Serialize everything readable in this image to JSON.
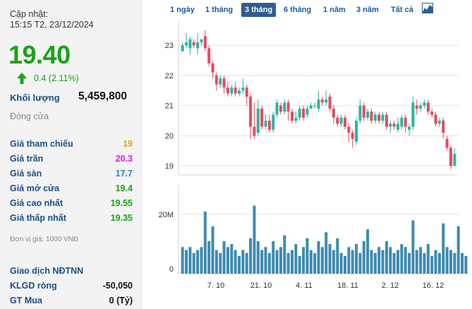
{
  "update": {
    "label": "Cập nhật:",
    "time": "15:15 T2, 23/12/2024"
  },
  "price": "19.40",
  "change": "0.4 (2.11%)",
  "volume": {
    "label": "Khối lượng",
    "value": "5,459,800"
  },
  "status": "Đóng cửa",
  "stats": [
    {
      "label": "Giá tham chiếu",
      "value": "19",
      "color": "#e8a600"
    },
    {
      "label": "Giá trần",
      "value": "20.3",
      "color": "#e020c8"
    },
    {
      "label": "Giá sàn",
      "value": "17.7",
      "color": "#2a87b8"
    },
    {
      "label": "Giá mở cửa",
      "value": "19.4",
      "color": "#1aa21a"
    },
    {
      "label": "Giá cao nhất",
      "value": "19.55",
      "color": "#1aa21a"
    },
    {
      "label": "Giá thấp nhất",
      "value": "19.35",
      "color": "#1aa21a"
    }
  ],
  "unit_note": "Đơn vị giá: 1000 VNĐ",
  "foreign": {
    "title": "Giao dịch NĐTNN",
    "rows": [
      {
        "label": "KLGD ròng",
        "value": "-50,050",
        "color": "#111111"
      },
      {
        "label": "GT Mua",
        "value": "0 (Tỷ)",
        "color": "#111111"
      }
    ]
  },
  "tabs": [
    "1 ngày",
    "1 tháng",
    "3 tháng",
    "6 tháng",
    "1 năm",
    "3 năm",
    "Tất cả"
  ],
  "active_tab": "3 tháng",
  "icons": {
    "chart_type": "area-chart-icon",
    "change_arrow": "up-arrow-icon"
  },
  "colors": {
    "up": "#2bb5a0",
    "down": "#e84a5f",
    "volume": "#3d8bb0",
    "accent_blue": "#2d5d94"
  },
  "chart_data": [
    {
      "type": "candlestick",
      "x_tick_labels": [
        "7. 10",
        "21. 10",
        "4. 11",
        "18. 11",
        "2. 12",
        "16. 12"
      ],
      "y_tick_labels": [
        "19",
        "20",
        "21",
        "22",
        "23"
      ],
      "ylim": [
        18.7,
        23.8
      ],
      "candles": [
        {
          "o": 22.8,
          "c": 23.0,
          "h": 23.1,
          "l": 22.8
        },
        {
          "o": 23.0,
          "c": 23.1,
          "h": 23.4,
          "l": 22.9
        },
        {
          "o": 22.9,
          "c": 23.2,
          "h": 23.3,
          "l": 22.7
        },
        {
          "o": 23.1,
          "c": 23.0,
          "h": 23.2,
          "l": 22.9
        },
        {
          "o": 22.9,
          "c": 23.1,
          "h": 23.4,
          "l": 22.7
        },
        {
          "o": 23.1,
          "c": 23.2,
          "h": 23.2,
          "l": 23.0
        },
        {
          "o": 23.3,
          "c": 22.9,
          "h": 23.5,
          "l": 22.8
        },
        {
          "o": 22.9,
          "c": 22.4,
          "h": 23.0,
          "l": 22.3
        },
        {
          "o": 22.4,
          "c": 22.1,
          "h": 22.5,
          "l": 21.9
        },
        {
          "o": 22.0,
          "c": 21.7,
          "h": 22.1,
          "l": 21.5
        },
        {
          "o": 21.7,
          "c": 21.9,
          "h": 22.0,
          "l": 21.6
        },
        {
          "o": 21.9,
          "c": 21.6,
          "h": 22.0,
          "l": 21.4
        },
        {
          "o": 21.6,
          "c": 21.4,
          "h": 21.8,
          "l": 21.3
        },
        {
          "o": 21.4,
          "c": 21.6,
          "h": 21.7,
          "l": 21.3
        },
        {
          "o": 21.6,
          "c": 21.4,
          "h": 21.8,
          "l": 21.3
        },
        {
          "o": 21.4,
          "c": 21.5,
          "h": 21.6,
          "l": 21.3
        },
        {
          "o": 21.5,
          "c": 21.6,
          "h": 21.9,
          "l": 21.4
        },
        {
          "o": 21.6,
          "c": 21.3,
          "h": 21.7,
          "l": 21.0
        },
        {
          "o": 21.3,
          "c": 20.3,
          "h": 21.4,
          "l": 19.9
        },
        {
          "o": 20.3,
          "c": 20.0,
          "h": 21.1,
          "l": 19.9
        },
        {
          "o": 20.1,
          "c": 20.9,
          "h": 21.2,
          "l": 20.0
        },
        {
          "o": 20.9,
          "c": 20.3,
          "h": 21.0,
          "l": 20.2
        },
        {
          "o": 20.3,
          "c": 20.5,
          "h": 20.7,
          "l": 20.2
        },
        {
          "o": 20.5,
          "c": 20.2,
          "h": 20.7,
          "l": 20.1
        },
        {
          "o": 20.2,
          "c": 20.7,
          "h": 20.8,
          "l": 20.1
        },
        {
          "o": 20.7,
          "c": 21.1,
          "h": 21.2,
          "l": 20.6
        },
        {
          "o": 21.0,
          "c": 20.8,
          "h": 21.1,
          "l": 20.7
        },
        {
          "o": 20.8,
          "c": 21.1,
          "h": 21.2,
          "l": 20.7
        },
        {
          "o": 21.1,
          "c": 20.8,
          "h": 21.2,
          "l": 20.5
        },
        {
          "o": 20.8,
          "c": 20.5,
          "h": 20.9,
          "l": 20.4
        },
        {
          "o": 20.5,
          "c": 20.6,
          "h": 20.8,
          "l": 20.4
        },
        {
          "o": 20.6,
          "c": 20.9,
          "h": 21.0,
          "l": 20.5
        },
        {
          "o": 20.9,
          "c": 20.6,
          "h": 21.0,
          "l": 20.5
        },
        {
          "o": 20.7,
          "c": 20.9,
          "h": 21.0,
          "l": 20.6
        },
        {
          "o": 20.9,
          "c": 21.0,
          "h": 21.1,
          "l": 20.9
        },
        {
          "o": 21.0,
          "c": 21.0,
          "h": 21.1,
          "l": 20.9
        },
        {
          "o": 20.9,
          "c": 21.2,
          "h": 21.5,
          "l": 20.8
        },
        {
          "o": 21.2,
          "c": 21.1,
          "h": 21.3,
          "l": 21.0
        },
        {
          "o": 21.1,
          "c": 21.2,
          "h": 21.5,
          "l": 21.0
        },
        {
          "o": 21.3,
          "c": 20.9,
          "h": 21.4,
          "l": 20.8
        },
        {
          "o": 20.9,
          "c": 20.6,
          "h": 21.0,
          "l": 20.4
        },
        {
          "o": 20.6,
          "c": 20.4,
          "h": 20.7,
          "l": 20.3
        },
        {
          "o": 20.4,
          "c": 20.6,
          "h": 20.7,
          "l": 20.3
        },
        {
          "o": 20.6,
          "c": 20.3,
          "h": 20.7,
          "l": 20.2
        },
        {
          "o": 20.3,
          "c": 20.1,
          "h": 20.4,
          "l": 19.8
        },
        {
          "o": 20.1,
          "c": 19.9,
          "h": 20.2,
          "l": 19.6
        },
        {
          "o": 19.8,
          "c": 20.5,
          "h": 20.6,
          "l": 19.7
        },
        {
          "o": 20.5,
          "c": 21.0,
          "h": 21.2,
          "l": 20.4
        },
        {
          "o": 21.0,
          "c": 20.6,
          "h": 21.1,
          "l": 20.5
        },
        {
          "o": 20.6,
          "c": 20.8,
          "h": 20.9,
          "l": 20.5
        },
        {
          "o": 20.8,
          "c": 20.5,
          "h": 20.9,
          "l": 20.4
        },
        {
          "o": 20.5,
          "c": 20.7,
          "h": 20.8,
          "l": 20.4
        },
        {
          "o": 20.7,
          "c": 20.5,
          "h": 20.8,
          "l": 20.4
        },
        {
          "o": 20.5,
          "c": 20.7,
          "h": 20.8,
          "l": 20.4
        },
        {
          "o": 20.7,
          "c": 20.3,
          "h": 20.8,
          "l": 20.2
        },
        {
          "o": 20.3,
          "c": 20.4,
          "h": 20.5,
          "l": 20.1
        },
        {
          "o": 20.4,
          "c": 20.3,
          "h": 20.5,
          "l": 20.2
        },
        {
          "o": 20.2,
          "c": 20.4,
          "h": 20.6,
          "l": 20.1
        },
        {
          "o": 20.3,
          "c": 20.6,
          "h": 20.7,
          "l": 20.2
        },
        {
          "o": 20.6,
          "c": 20.3,
          "h": 20.7,
          "l": 20.1
        },
        {
          "o": 20.2,
          "c": 20.3,
          "h": 20.4,
          "l": 20.0
        },
        {
          "o": 20.3,
          "c": 21.1,
          "h": 21.3,
          "l": 20.2
        },
        {
          "o": 21.0,
          "c": 20.9,
          "h": 21.2,
          "l": 20.7
        },
        {
          "o": 20.9,
          "c": 21.0,
          "h": 21.1,
          "l": 20.8
        },
        {
          "o": 21.0,
          "c": 21.1,
          "h": 21.2,
          "l": 20.9
        },
        {
          "o": 21.1,
          "c": 20.8,
          "h": 21.2,
          "l": 20.7
        },
        {
          "o": 20.8,
          "c": 20.7,
          "h": 20.9,
          "l": 20.6
        },
        {
          "o": 20.7,
          "c": 20.4,
          "h": 20.8,
          "l": 20.3
        },
        {
          "o": 20.4,
          "c": 20.5,
          "h": 20.6,
          "l": 20.3
        },
        {
          "o": 20.5,
          "c": 20.1,
          "h": 20.6,
          "l": 19.9
        },
        {
          "o": 19.9,
          "c": 19.6,
          "h": 20.0,
          "l": 19.5
        },
        {
          "o": 19.6,
          "c": 19.0,
          "h": 19.7,
          "l": 18.9
        },
        {
          "o": 19.0,
          "c": 19.4,
          "h": 19.6,
          "l": 19.0
        }
      ],
      "volume": {
        "y_tick_labels": [
          "0",
          "20M"
        ],
        "values": [
          9,
          8,
          9,
          7,
          8,
          9,
          21,
          11,
          16,
          8,
          7,
          11,
          9,
          10,
          8,
          6,
          8,
          7,
          12,
          23,
          11,
          8,
          9,
          7,
          11,
          8,
          9,
          13,
          7,
          8,
          10,
          6,
          9,
          12,
          8,
          7,
          11,
          9,
          14,
          10,
          8,
          12,
          7,
          6,
          9,
          8,
          10,
          7,
          11,
          15,
          8,
          7,
          9,
          8,
          11,
          9,
          7,
          8,
          10,
          9,
          7,
          18,
          8,
          9,
          7,
          10,
          6,
          8,
          7,
          17,
          9,
          8,
          7,
          16,
          7,
          6
        ]
      }
    }
  ]
}
